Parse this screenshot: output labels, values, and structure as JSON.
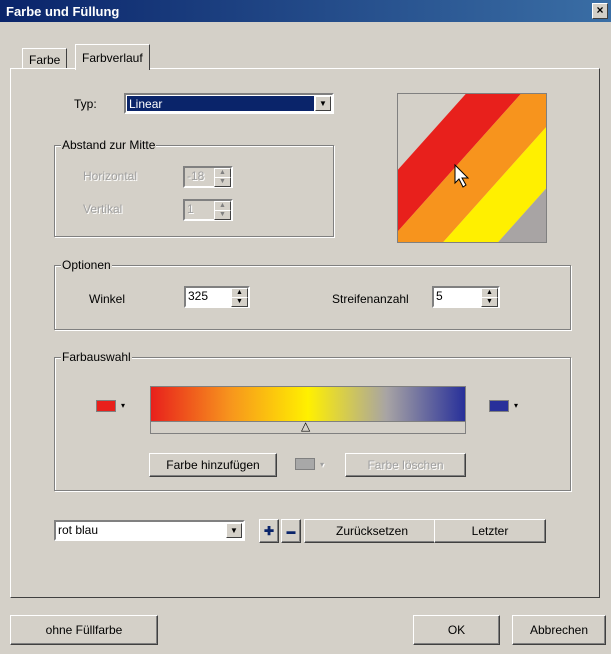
{
  "window": {
    "title": "Farbe und Füllung",
    "close_glyph": "×"
  },
  "tabs": [
    {
      "label": "Farbe"
    },
    {
      "label": "Farbverlauf"
    }
  ],
  "type_row": {
    "label": "Typ:",
    "value": "Linear"
  },
  "center_group": {
    "label": "Abstand zur Mitte",
    "horizontal_label": "Horizontal",
    "horizontal_value": "-18",
    "vertical_label": "Vertikal",
    "vertical_value": "1"
  },
  "options_group": {
    "label": "Optionen",
    "angle_label": "Winkel",
    "angle_value": "325",
    "stripes_label": "Streifenanzahl",
    "stripes_value": "5"
  },
  "color_group": {
    "label": "Farbauswahl",
    "add_color_label": "Farbe hinzufügen",
    "delete_color_label": "Farbe löschen",
    "start_color": "#e8201c",
    "end_color": "#28309a",
    "middle_color": "#a8a8a8",
    "marker_glyph": "△"
  },
  "preset_row": {
    "preset_value": "rot blau",
    "plus_label": "✚",
    "minus_label": "▬",
    "reset_label": "Zurücksetzen",
    "last_label": "Letzter"
  },
  "footer": {
    "no_fill_label": "ohne Füllfarbe",
    "ok_label": "OK",
    "cancel_label": "Abbrechen"
  },
  "glyphs": {
    "arrow_down": "▼",
    "spin_up": "▲",
    "spin_down": "▼",
    "small_down": "▾"
  },
  "preview_colors": [
    "#e8201c",
    "#f7941d",
    "#fff000",
    "#a8a4a4",
    "#28309a"
  ]
}
